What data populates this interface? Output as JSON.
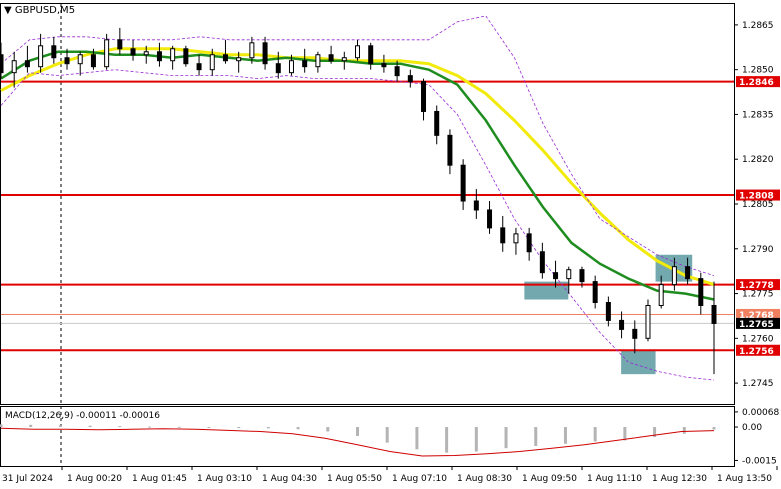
{
  "chart_data": [
    {
      "type": "line",
      "title": "GBPUSD,M5",
      "ylim": [
        1.2738,
        1.2872
      ],
      "y_ticks": [
        1.2865,
        1.285,
        1.2835,
        1.282,
        1.2805,
        1.279,
        1.2775,
        1.276,
        1.2745
      ],
      "y_tick_labels": [
        "1.2865",
        "1.2850",
        "1.2835",
        "1.2820",
        "1.2805",
        "1.2790",
        "1.2775",
        "1.2760",
        "1.2745"
      ],
      "x_tick_labels": [
        "31 Jul 2024",
        "1 Aug 00:20",
        "1 Aug 01:45",
        "1 Aug 03:10",
        "1 Aug 04:30",
        "1 Aug 05:50",
        "1 Aug 07:10",
        "1 Aug 08:30",
        "1 Aug 09:50",
        "1 Aug 11:10",
        "1 Aug 12:30",
        "1 Aug 13:50"
      ],
      "horizontal_levels": [
        {
          "value": 1.2846,
          "label": "1.2846",
          "color": "#e00000"
        },
        {
          "value": 1.2808,
          "label": "1.2808",
          "color": "#e00000"
        },
        {
          "value": 1.2778,
          "label": "1.2778",
          "color": "#e00000"
        },
        {
          "value": 1.2756,
          "label": "1.2756",
          "color": "#e00000"
        }
      ],
      "current_price": {
        "value": 1.2765,
        "label": "1.2765",
        "color": "#000000"
      },
      "bid_line": {
        "value": 1.2768,
        "label": "1.2768",
        "color": "#f08060"
      },
      "series": [
        {
          "color": "#f2ea0b",
          "values": [
            1.2843,
            1.2848,
            1.2852,
            1.2855,
            1.2857,
            1.2857,
            1.2857,
            1.2856,
            1.2855,
            1.2855,
            1.2854,
            1.2854,
            1.2853,
            1.2853,
            1.2853,
            1.2852,
            1.2848,
            1.2842,
            1.2833,
            1.2823,
            1.2812,
            1.2802,
            1.2793,
            1.2786,
            1.2781,
            1.2778
          ]
        },
        {
          "color": "#1e8c1e",
          "values": [
            1.2847,
            1.2853,
            1.2856,
            1.2856,
            1.2855,
            1.2855,
            1.2854,
            1.2855,
            1.2854,
            1.2853,
            1.2854,
            1.2853,
            1.2853,
            1.2852,
            1.2852,
            1.285,
            1.2845,
            1.2833,
            1.2818,
            1.2804,
            1.2792,
            1.2785,
            1.278,
            1.2776,
            1.2775,
            1.2773
          ]
        },
        {
          "color": "#9a2bd6",
          "values": [
            1.2852,
            1.286,
            1.2861,
            1.2861,
            1.286,
            1.286,
            1.286,
            1.2861,
            1.286,
            1.286,
            1.286,
            1.286,
            1.286,
            1.286,
            1.286,
            1.286,
            1.2866,
            1.2868,
            1.2854,
            1.2832,
            1.2815,
            1.28,
            1.2794,
            1.2788,
            1.2784,
            1.2781
          ]
        },
        {
          "color": "#9a2bd6",
          "values": [
            1.2838,
            1.2849,
            1.2848,
            1.2849,
            1.285,
            1.2849,
            1.2848,
            1.2848,
            1.2848,
            1.2847,
            1.2848,
            1.2847,
            1.2847,
            1.2847,
            1.2846,
            1.2845,
            1.2835,
            1.2818,
            1.28,
            1.2786,
            1.2774,
            1.2762,
            1.2752,
            1.2749,
            1.2747,
            1.2746
          ]
        }
      ],
      "candles": [
        [
          1.2855,
          1.2859,
          1.2847,
          1.2849
        ],
        [
          1.2849,
          1.2856,
          1.2844,
          1.2853
        ],
        [
          1.2853,
          1.2858,
          1.2849,
          1.2851
        ],
        [
          1.2851,
          1.2862,
          1.2849,
          1.2858
        ],
        [
          1.2858,
          1.2861,
          1.2852,
          1.2854
        ],
        [
          1.2854,
          1.2857,
          1.285,
          1.2852
        ],
        [
          1.2852,
          1.2856,
          1.2848,
          1.2855
        ],
        [
          1.2855,
          1.2857,
          1.285,
          1.2851
        ],
        [
          1.2851,
          1.2862,
          1.285,
          1.286
        ],
        [
          1.286,
          1.2864,
          1.2855,
          1.2857
        ],
        [
          1.2857,
          1.286,
          1.2853,
          1.2855
        ],
        [
          1.2855,
          1.2858,
          1.2852,
          1.2856
        ],
        [
          1.2856,
          1.2859,
          1.2851,
          1.2853
        ],
        [
          1.2853,
          1.2858,
          1.285,
          1.2857
        ],
        [
          1.2857,
          1.2858,
          1.2851,
          1.2852
        ],
        [
          1.2852,
          1.2855,
          1.2848,
          1.285
        ],
        [
          1.285,
          1.2857,
          1.2848,
          1.2855
        ],
        [
          1.2855,
          1.286,
          1.2852,
          1.2853
        ],
        [
          1.2853,
          1.2856,
          1.2849,
          1.2854
        ],
        [
          1.2854,
          1.2861,
          1.2852,
          1.2859
        ],
        [
          1.2859,
          1.2861,
          1.285,
          1.2852
        ],
        [
          1.2852,
          1.2856,
          1.2847,
          1.2849
        ],
        [
          1.2849,
          1.2855,
          1.2848,
          1.2853
        ],
        [
          1.2853,
          1.2857,
          1.2849,
          1.2851
        ],
        [
          1.2851,
          1.2856,
          1.2849,
          1.2855
        ],
        [
          1.2855,
          1.2858,
          1.2852,
          1.2853
        ],
        [
          1.2853,
          1.2856,
          1.285,
          1.2854
        ],
        [
          1.2854,
          1.286,
          1.2853,
          1.2858
        ],
        [
          1.2858,
          1.2859,
          1.285,
          1.2852
        ],
        [
          1.2852,
          1.2855,
          1.2849,
          1.2851
        ],
        [
          1.2851,
          1.2853,
          1.2846,
          1.2848
        ],
        [
          1.2848,
          1.285,
          1.2844,
          1.2846
        ],
        [
          1.2846,
          1.2847,
          1.2833,
          1.2836
        ],
        [
          1.2836,
          1.2838,
          1.2825,
          1.2828
        ],
        [
          1.2828,
          1.283,
          1.2815,
          1.2818
        ],
        [
          1.2818,
          1.282,
          1.2803,
          1.2806
        ],
        [
          1.2806,
          1.281,
          1.28,
          1.2803
        ],
        [
          1.2803,
          1.2806,
          1.2795,
          1.2797
        ],
        [
          1.2797,
          1.2801,
          1.2789,
          1.2792
        ],
        [
          1.2792,
          1.2797,
          1.2788,
          1.2795
        ],
        [
          1.2795,
          1.2797,
          1.2786,
          1.2789
        ],
        [
          1.2789,
          1.2792,
          1.278,
          1.2782
        ],
        [
          1.2782,
          1.2786,
          1.2777,
          1.278
        ],
        [
          1.278,
          1.2784,
          1.2775,
          1.2783
        ],
        [
          1.2783,
          1.2784,
          1.2777,
          1.2779
        ],
        [
          1.2779,
          1.2781,
          1.277,
          1.2772
        ],
        [
          1.2772,
          1.2774,
          1.2764,
          1.2766
        ],
        [
          1.2766,
          1.2769,
          1.276,
          1.2763
        ],
        [
          1.2763,
          1.2766,
          1.2755,
          1.276
        ],
        [
          1.276,
          1.2773,
          1.2759,
          1.2771
        ],
        [
          1.2771,
          1.2781,
          1.277,
          1.2778
        ],
        [
          1.2778,
          1.2787,
          1.2776,
          1.2784
        ],
        [
          1.2784,
          1.2787,
          1.2778,
          1.278
        ],
        [
          1.278,
          1.2782,
          1.2768,
          1.2771
        ],
        [
          1.2771,
          1.2779,
          1.2748,
          1.2765
        ]
      ],
      "zones": [
        {
          "x_range": [
            0.714,
            0.774
          ],
          "y_range": [
            1.2773,
            1.2779
          ],
          "color": "#5b9aa0"
        },
        {
          "x_range": [
            0.846,
            0.893
          ],
          "y_range": [
            1.2748,
            1.2756
          ],
          "color": "#5b9aa0"
        },
        {
          "x_range": [
            0.893,
            0.943
          ],
          "y_range": [
            1.2779,
            1.2788
          ],
          "color": "#5b9aa0"
        }
      ]
    },
    {
      "type": "bar",
      "title": "MACD(12,26,9) -0.00011 -0.00016",
      "ylim": [
        -0.00175,
        0.0009
      ],
      "y_ticks": [
        0.00068,
        0.0,
        -0.0015
      ],
      "y_tick_labels": [
        "0.00068",
        "0.00",
        "-0.0015"
      ],
      "values": [
        0.00012,
        0.0001,
        8e-05,
        6e-05,
        4e-05,
        2e-05,
        1e-05,
        -2e-05,
        -4e-05,
        -6e-05,
        -0.0001,
        -0.0002,
        -0.0004,
        -0.0007,
        -0.001,
        -0.00115,
        -0.0011,
        -0.00095,
        -0.00085,
        -0.00075,
        -0.00065,
        -0.0006,
        -0.00045,
        -0.0003,
        -0.00011
      ],
      "series": [
        {
          "color": "#d00000",
          "values": [
            -5e-05,
            -0.0001,
            -0.0001,
            -0.00012,
            -0.0001,
            -8e-05,
            -0.0001,
            -0.00015,
            -0.0002,
            -0.0003,
            -0.0005,
            -0.0008,
            -0.0011,
            -0.0013,
            -0.00128,
            -0.0012,
            -0.0011,
            -0.00095,
            -0.0008,
            -0.0006,
            -0.0004,
            -0.0002,
            -0.00016
          ]
        }
      ]
    }
  ]
}
